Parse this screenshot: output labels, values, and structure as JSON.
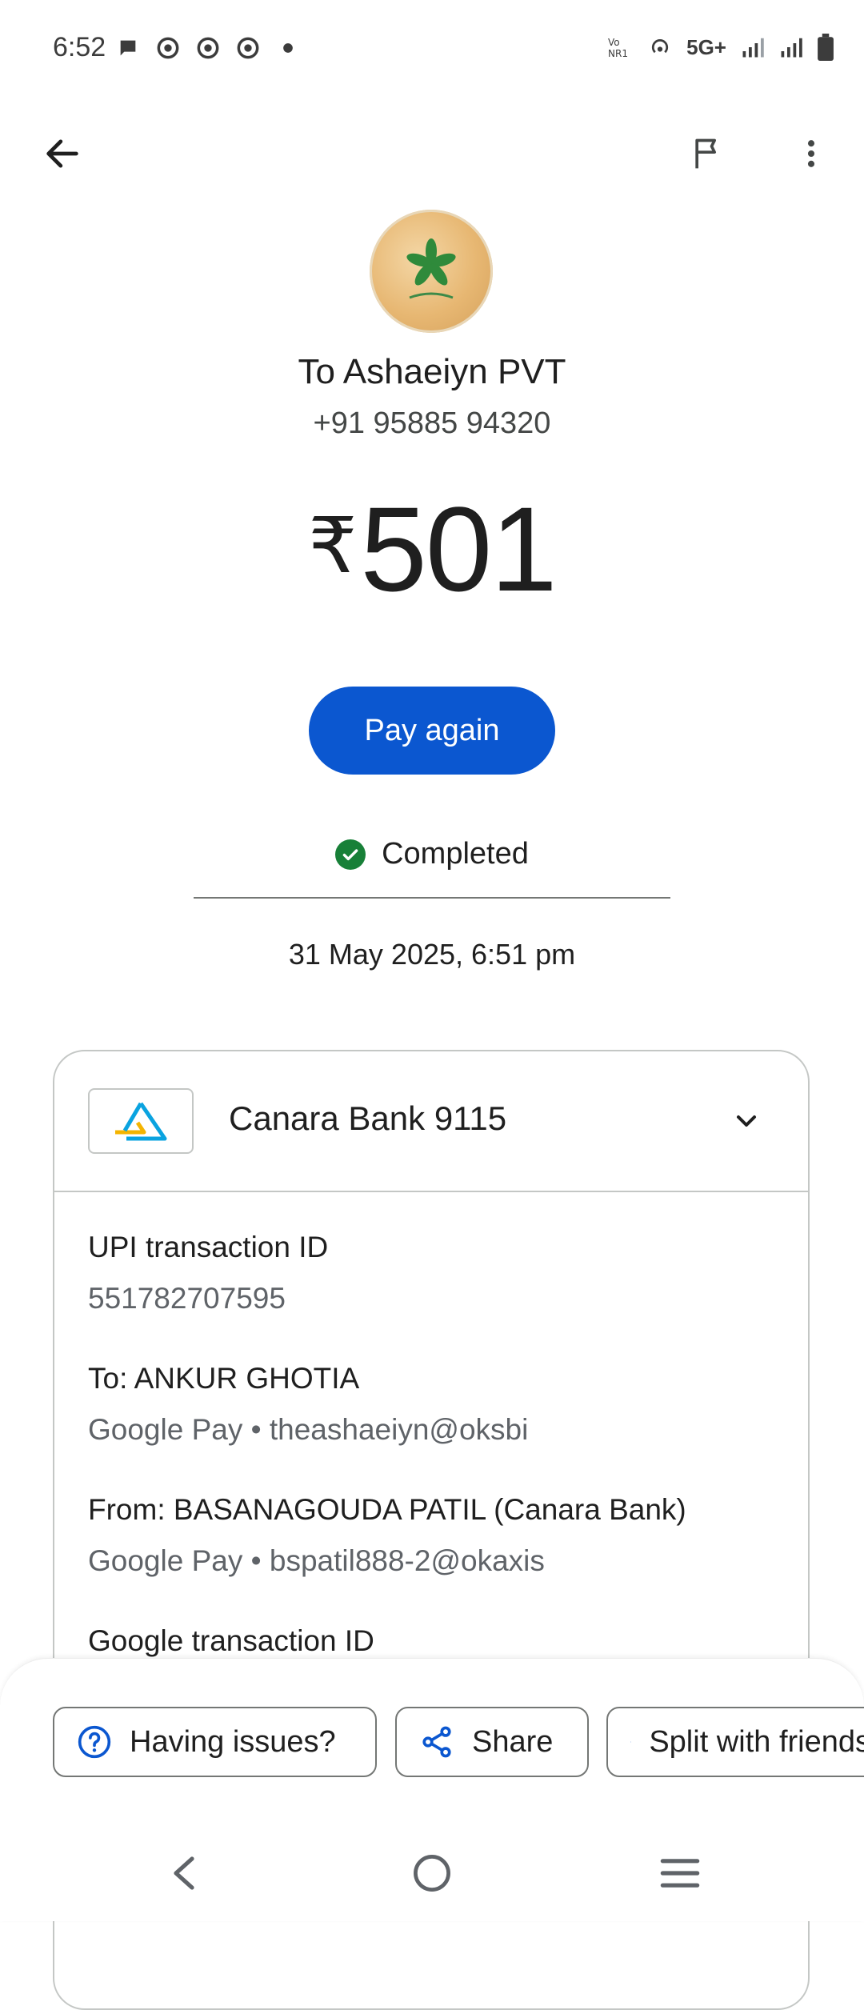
{
  "status_bar": {
    "time": "6:52",
    "network_label": "5G+",
    "left_icons": [
      "chat-bubble-icon",
      "chrome-icon",
      "chrome-icon",
      "chrome-icon",
      "dot-icon"
    ],
    "right_icons": [
      "volte-icon",
      "hotspot-icon",
      "signal-icon",
      "signal-icon",
      "battery-icon"
    ]
  },
  "appbar": {
    "back_icon": "arrow-back-icon",
    "flag_icon": "flag-icon",
    "more_icon": "more-vert-icon"
  },
  "header": {
    "recipient": "To Ashaeiyn PVT",
    "phone": "+91 95885 94320",
    "currency": "₹",
    "amount": "501",
    "pay_again_label": "Pay again",
    "status": "Completed",
    "datetime": "31 May 2025, 6:51 pm"
  },
  "colors": {
    "primary": "#0b57d0",
    "success": "#188038",
    "text": "#1f1f1f",
    "secondary_text": "#5f6368",
    "outline": "#c4c7c5"
  },
  "card": {
    "bank_name": "Canara Bank 9115",
    "details": [
      {
        "label": "UPI transaction ID",
        "value": "551782707595"
      },
      {
        "label": "To: ANKUR GHOTIA",
        "value": "Google Pay • theashaeiyn@oksbi"
      },
      {
        "label": "From: BASANAGOUDA  PATIL (Canara Bank)",
        "value": "Google Pay • bspatil888-2@okaxis"
      },
      {
        "label": "Google transaction ID",
        "value": ""
      }
    ]
  },
  "actions": {
    "issues_label": "Having issues?",
    "share_label": "Share",
    "split_label": "Split with friends"
  }
}
